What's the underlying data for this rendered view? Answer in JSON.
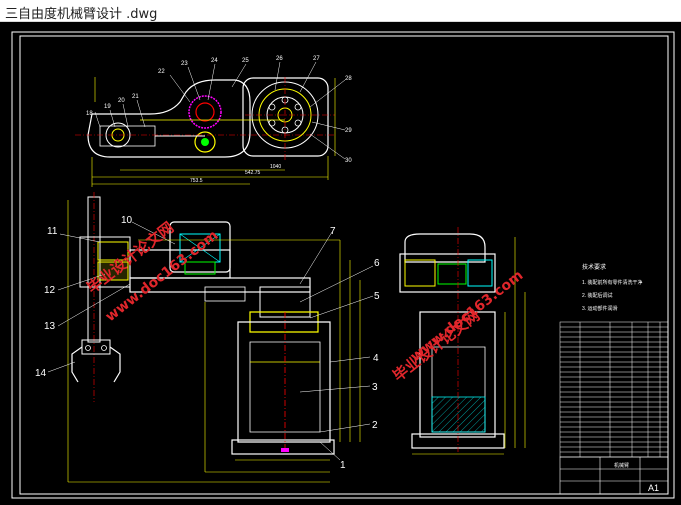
{
  "window": {
    "title": "三自由度机械臂设计 .dwg"
  },
  "drawing": {
    "top_view_callouts": [
      "18",
      "19",
      "20",
      "21",
      "22",
      "23",
      "24",
      "25",
      "26",
      "27",
      "28",
      "29",
      "30"
    ],
    "front_view_callouts": [
      "1",
      "2",
      "3",
      "4",
      "5",
      "6",
      "7",
      "10",
      "11",
      "12",
      "13",
      "14"
    ],
    "dims": {
      "top_width": "1040",
      "top_a": "542.75",
      "top_b": "753.5"
    },
    "tech_title": "技术要求",
    "tech_lines": [
      "1. 装配前所有零件清洗干净",
      "2. 装配后调试",
      "3. 运动部件润滑"
    ],
    "watermarks": [
      {
        "text": "毕业设计论文网",
        "id": "wm1"
      },
      {
        "text": "www.doc163.com",
        "id": "wm2"
      },
      {
        "text": "毕业设计论文网",
        "id": "wm3"
      },
      {
        "text": "www.doc163.com",
        "id": "wm4"
      }
    ],
    "title_block": {
      "name": "机械臂",
      "sheet": "A1"
    },
    "colors": {
      "background": "#000000",
      "line_white": "#ffffff",
      "line_yellow": "#ffff00",
      "line_green": "#00ff00",
      "line_cyan": "#00ffff",
      "line_red": "#ff0000",
      "line_magenta": "#ff00ff",
      "watermark": "#e0262b"
    }
  }
}
